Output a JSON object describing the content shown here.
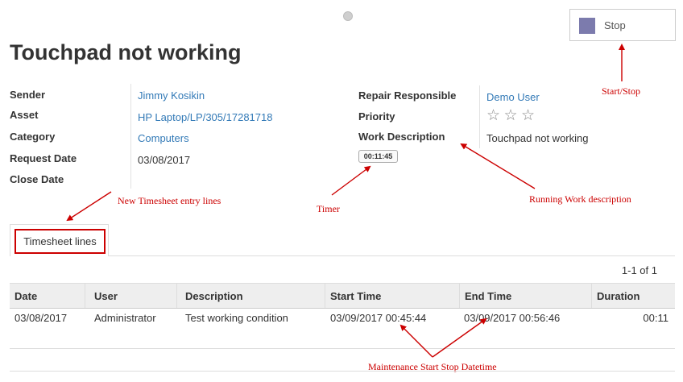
{
  "header": {
    "title": "Touchpad not working",
    "stop_button_label": "Stop",
    "stop_color": "#7c7bad"
  },
  "form": {
    "left_fields": [
      {
        "label": "Sender",
        "value": "Jimmy Kosikin",
        "link": true
      },
      {
        "label": "Asset",
        "value": "HP Laptop/LP/305/17281718",
        "link": true
      },
      {
        "label": "Category",
        "value": "Computers",
        "link": true
      },
      {
        "label": "Request Date",
        "value": "03/08/2017",
        "link": false
      },
      {
        "label": "Close Date",
        "value": "",
        "link": false
      }
    ],
    "repair_responsible_label": "Repair Responsible",
    "repair_responsible_value": "Demo User",
    "priority_label": "Priority",
    "priority_stars": 3,
    "priority_value": 0,
    "work_description_label": "Work Description",
    "work_description_value": "Touchpad not working",
    "timer": "00:11:45"
  },
  "tabs": [
    {
      "label": "Timesheet lines"
    }
  ],
  "pager": "1-1 of 1",
  "table": {
    "columns": [
      "Date",
      "User",
      "Description",
      "Start Time",
      "End Time",
      "Duration"
    ],
    "rows": [
      [
        "03/08/2017",
        "Administrator",
        "Test working condition",
        "03/09/2017 00:45:44",
        "03/09/2017 00:56:46",
        "00:11"
      ]
    ]
  },
  "annotations": {
    "start_stop": "Start/Stop",
    "timesheet_lines": "New Timesheet entry lines",
    "timer": "Timer",
    "work_description": "Running Work description",
    "start_stop_datetime": "Maintenance Start Stop Datetime"
  },
  "colors": {
    "link": "#337ab7",
    "annotation": "#cc0000"
  }
}
